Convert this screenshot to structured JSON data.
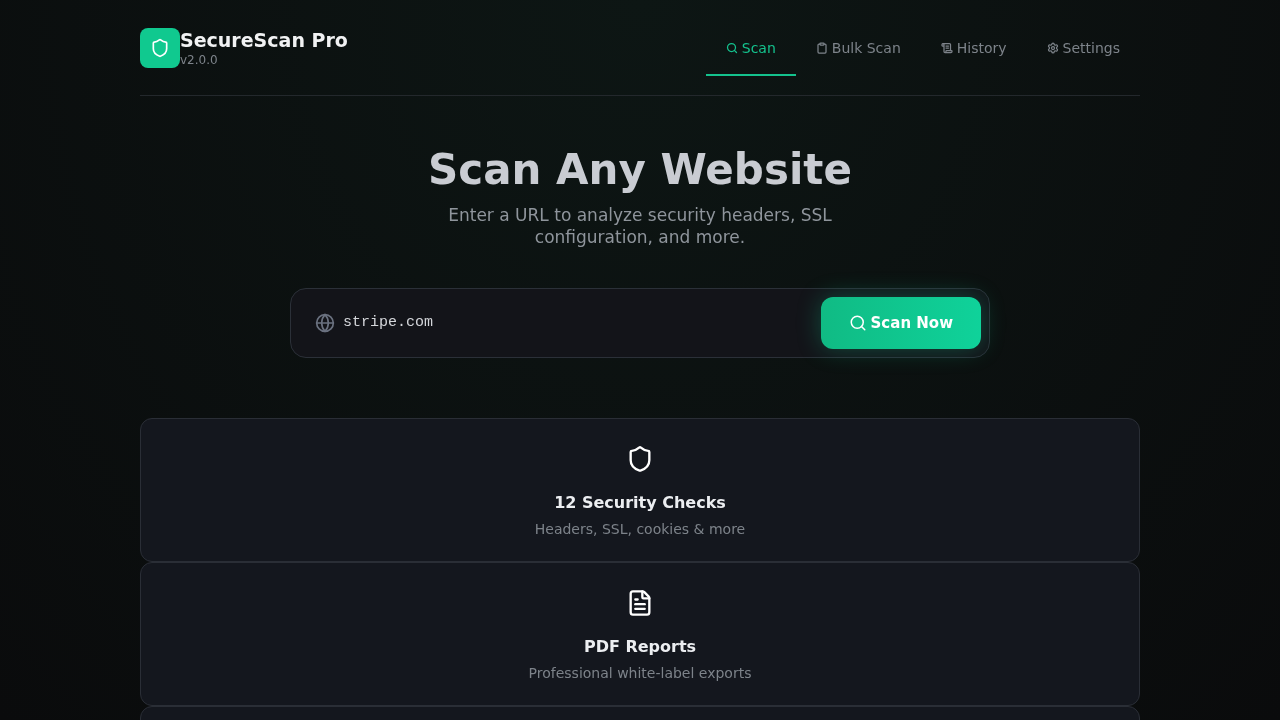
{
  "brand": {
    "name": "SecureScan Pro",
    "version": "v2.0.0"
  },
  "nav": [
    {
      "label": "Scan",
      "kind": "search",
      "selected": true
    },
    {
      "label": "Bulk Scan",
      "kind": "clipboard",
      "selected": false
    },
    {
      "label": "History",
      "kind": "scroll",
      "selected": false
    },
    {
      "label": "Settings",
      "kind": "gear",
      "selected": false
    }
  ],
  "hero": {
    "title": "Scan Any Website",
    "subtitle": "Enter a URL to analyze security headers, SSL configuration, and more."
  },
  "scan": {
    "value": "stripe.com",
    "button": "Scan Now"
  },
  "features": [
    {
      "kind": "shield",
      "title": "12 Security Checks",
      "text": "Headers, SSL, cookies & more"
    },
    {
      "kind": "document",
      "title": "PDF Reports",
      "text": "Professional white-label exports"
    },
    {
      "kind": "hidden"
    }
  ]
}
